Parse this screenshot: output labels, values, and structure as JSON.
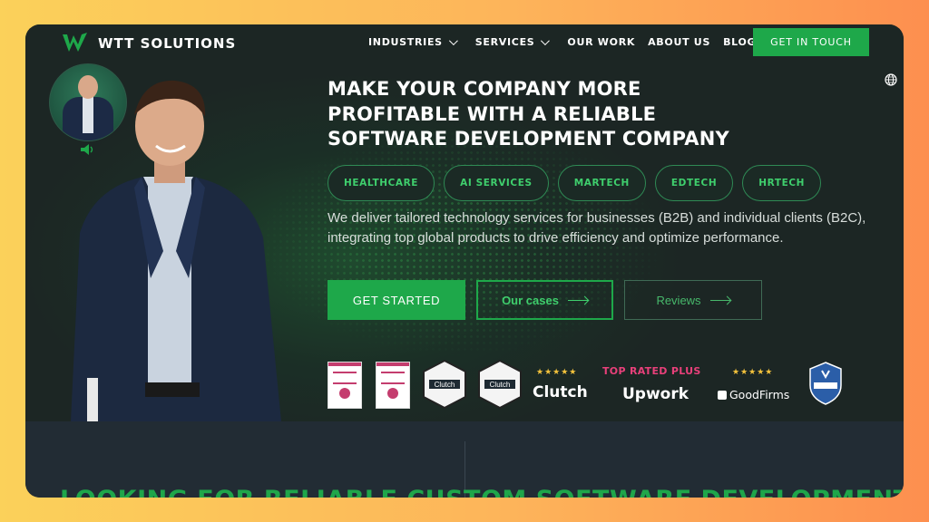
{
  "brand": {
    "name": "WTT SOLUTIONS",
    "accent": "#1ea84a",
    "logo_icon": "wtt-logo-icon"
  },
  "nav": {
    "items": [
      {
        "label": "INDUSTRIES",
        "has_dropdown": true
      },
      {
        "label": "SERVICES",
        "has_dropdown": true
      },
      {
        "label": "OUR WORK"
      },
      {
        "label": "ABOUT US"
      },
      {
        "label": "BLOG"
      }
    ],
    "cta": "GET IN TOUCH"
  },
  "hero": {
    "headline": "MAKE YOUR COMPANY MORE PROFITABLE WITH A RELIABLE SOFTWARE DEVELOPMENT COMPANY",
    "tags": [
      "HEALTHCARE",
      "AI SERVICES",
      "MARTECH",
      "EDTECH",
      "HRTECH"
    ],
    "description": "We deliver tailored technology services for businesses (B2B) and individual clients (B2C), integrating top global products to drive efficiency and optimize performance.",
    "buttons": {
      "start": "GET STARTED",
      "cases": "Our cases",
      "reviews": "Reviews"
    }
  },
  "badges": {
    "clutch_word": "Clutch",
    "clutch_inner": "Clutch",
    "stars": "★★★★★",
    "top_rated": "TOP RATED PLUS",
    "upwork": "Upwork",
    "goodfirms": "GoodFirms"
  },
  "lower": {
    "teaser": "LOOKING FOR RELIABLE CUSTOM SOFTWARE DEVELOPMENT"
  }
}
